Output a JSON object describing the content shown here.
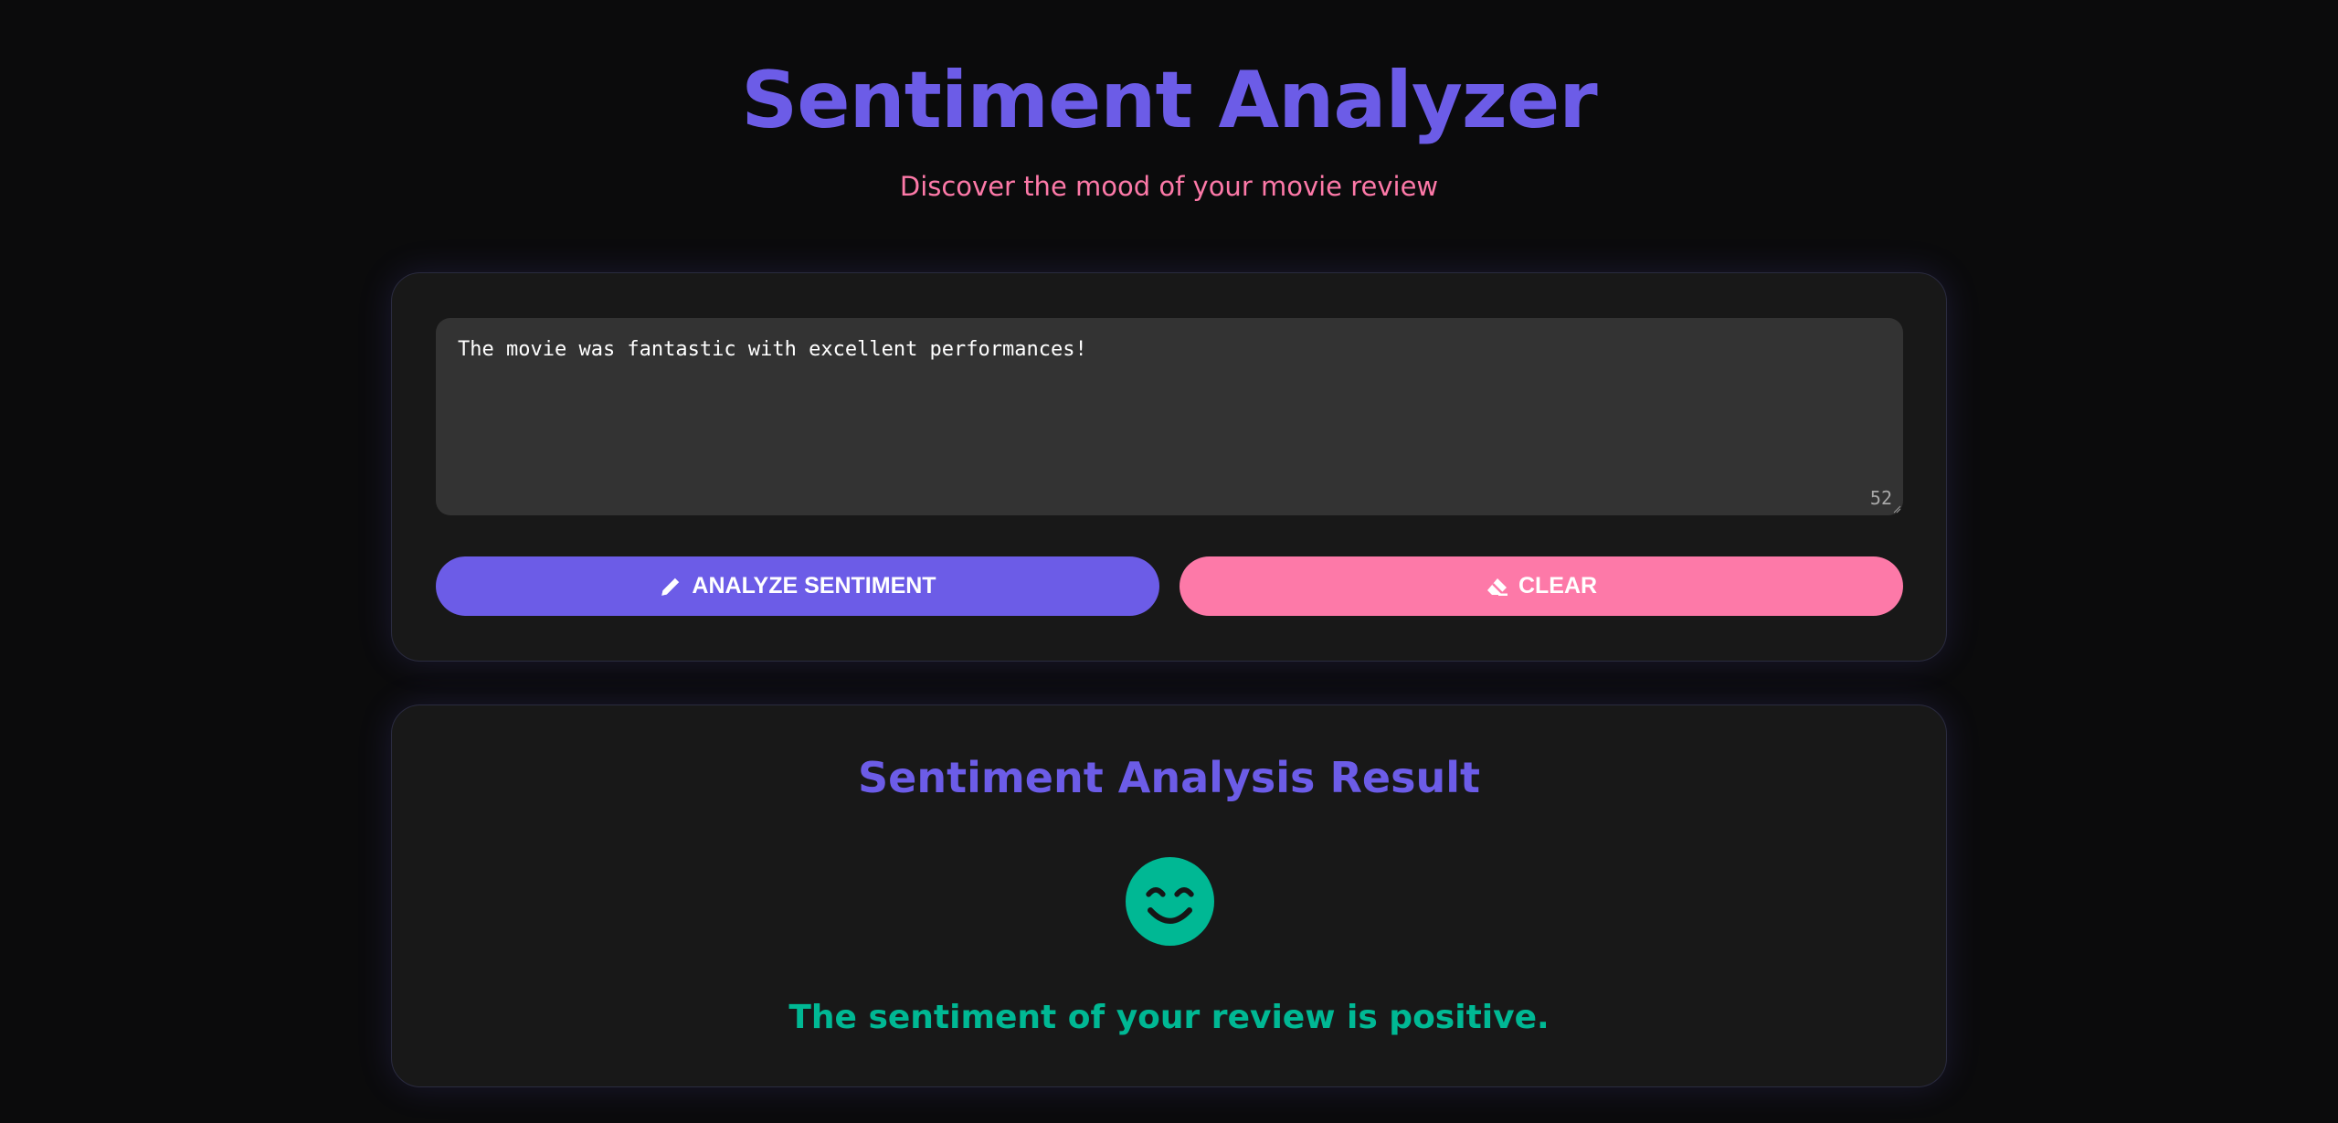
{
  "header": {
    "title": "Sentiment Analyzer",
    "subtitle": "Discover the mood of your movie review"
  },
  "input": {
    "value": "The movie was fantastic with excellent performances!",
    "char_count": "52"
  },
  "buttons": {
    "analyze_label": "ANALYZE SENTIMENT",
    "analyze_icon": "pencil-icon",
    "clear_label": "CLEAR",
    "clear_icon": "eraser-icon"
  },
  "result": {
    "title": "Sentiment Analysis Result",
    "icon": "smiling-face-icon",
    "sentiment": "positive",
    "message": "The sentiment of your review is positive."
  },
  "colors": {
    "background": "#0b0b0c",
    "card": "#181818",
    "accent_purple": "#6c5ce7",
    "accent_pink": "#fd79a8",
    "positive_green": "#00b894",
    "textarea": "#333333"
  }
}
